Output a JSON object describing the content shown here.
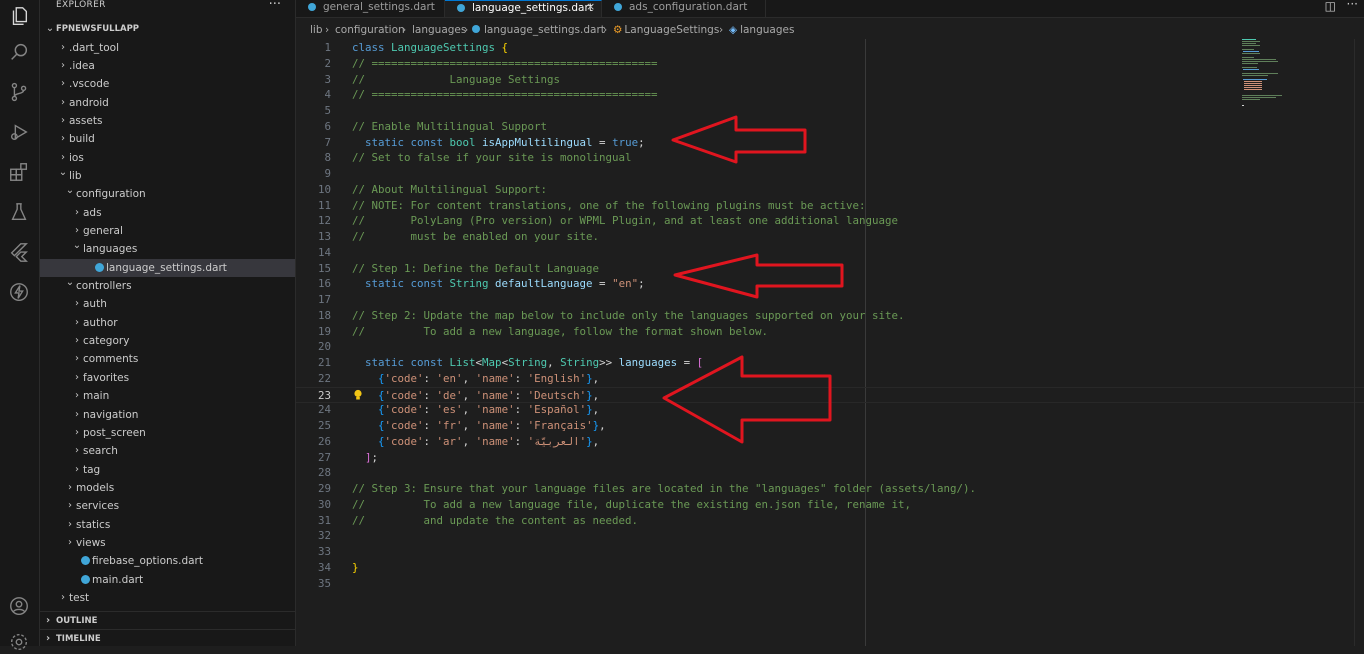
{
  "activity_bar": {
    "icons": [
      "explorer-icon",
      "search-icon",
      "source-control-icon",
      "run-debug-icon",
      "extensions-icon",
      "testing-icon",
      "flutter-icon",
      "lightning-icon",
      "account-icon",
      "settings-icon"
    ]
  },
  "explorer": {
    "title": "EXPLORER",
    "more": "···",
    "root": "FPNEWSFULLAPP",
    "items": [
      {
        "label": ".dart_tool",
        "depth": 1,
        "kind": "folder-closed"
      },
      {
        "label": ".idea",
        "depth": 1,
        "kind": "folder-closed"
      },
      {
        "label": ".vscode",
        "depth": 1,
        "kind": "folder-closed"
      },
      {
        "label": "android",
        "depth": 1,
        "kind": "folder-closed"
      },
      {
        "label": "assets",
        "depth": 1,
        "kind": "folder-closed"
      },
      {
        "label": "build",
        "depth": 1,
        "kind": "folder-closed"
      },
      {
        "label": "ios",
        "depth": 1,
        "kind": "folder-closed"
      },
      {
        "label": "lib",
        "depth": 1,
        "kind": "folder-open"
      },
      {
        "label": "configuration",
        "depth": 2,
        "kind": "folder-open"
      },
      {
        "label": "ads",
        "depth": 3,
        "kind": "folder-closed"
      },
      {
        "label": "general",
        "depth": 3,
        "kind": "folder-closed"
      },
      {
        "label": "languages",
        "depth": 3,
        "kind": "folder-open"
      },
      {
        "label": "language_settings.dart",
        "depth": 4,
        "kind": "dart-file",
        "selected": true
      },
      {
        "label": "controllers",
        "depth": 2,
        "kind": "folder-open"
      },
      {
        "label": "auth",
        "depth": 3,
        "kind": "folder-closed"
      },
      {
        "label": "author",
        "depth": 3,
        "kind": "folder-closed"
      },
      {
        "label": "category",
        "depth": 3,
        "kind": "folder-closed"
      },
      {
        "label": "comments",
        "depth": 3,
        "kind": "folder-closed"
      },
      {
        "label": "favorites",
        "depth": 3,
        "kind": "folder-closed"
      },
      {
        "label": "main",
        "depth": 3,
        "kind": "folder-closed"
      },
      {
        "label": "navigation",
        "depth": 3,
        "kind": "folder-closed"
      },
      {
        "label": "post_screen",
        "depth": 3,
        "kind": "folder-closed"
      },
      {
        "label": "search",
        "depth": 3,
        "kind": "folder-closed"
      },
      {
        "label": "tag",
        "depth": 3,
        "kind": "folder-closed"
      },
      {
        "label": "models",
        "depth": 2,
        "kind": "folder-closed"
      },
      {
        "label": "services",
        "depth": 2,
        "kind": "folder-closed"
      },
      {
        "label": "statics",
        "depth": 2,
        "kind": "folder-closed"
      },
      {
        "label": "views",
        "depth": 2,
        "kind": "folder-closed"
      },
      {
        "label": "firebase_options.dart",
        "depth": 2,
        "kind": "dart-file"
      },
      {
        "label": "main.dart",
        "depth": 2,
        "kind": "dart-file"
      },
      {
        "label": "test",
        "depth": 1,
        "kind": "folder-closed"
      }
    ],
    "outline": "OUTLINE",
    "timeline": "TIMELINE"
  },
  "tabs": [
    {
      "label": "general_settings.dart",
      "active": false
    },
    {
      "label": "language_settings.dart",
      "active": true,
      "close": "×"
    },
    {
      "label": "ads_configuration.dart",
      "active": false
    }
  ],
  "breadcrumb": [
    "lib",
    "configuration",
    "languages",
    "language_settings.dart",
    "LanguageSettings",
    "languages"
  ],
  "breadcrumb_sep": "›",
  "code_lines": [
    [
      {
        "t": "class ",
        "c": "kw"
      },
      {
        "t": "LanguageSettings",
        "c": "cls"
      },
      {
        "t": " {",
        "c": "y"
      }
    ],
    [
      {
        "t": "// ============================================",
        "c": "cmt"
      }
    ],
    [
      {
        "t": "//             Language Settings",
        "c": "cmt"
      }
    ],
    [
      {
        "t": "// ============================================",
        "c": "cmt"
      }
    ],
    [],
    [
      {
        "t": "// Enable Multilingual Support",
        "c": "cmt"
      }
    ],
    [
      {
        "t": "  static const ",
        "c": "kw"
      },
      {
        "t": "bool ",
        "c": "cls"
      },
      {
        "t": "isAppMultilingual",
        "c": "var"
      },
      {
        "t": " = ",
        "c": "p"
      },
      {
        "t": "true",
        "c": "kw"
      },
      {
        "t": ";",
        "c": "p"
      }
    ],
    [
      {
        "t": "// Set to false if your site is monolingual",
        "c": "cmt"
      }
    ],
    [],
    [
      {
        "t": "// About Multilingual Support:",
        "c": "cmt"
      }
    ],
    [
      {
        "t": "// NOTE: For content translations, one of the following plugins must be active:",
        "c": "cmt"
      }
    ],
    [
      {
        "t": "//       PolyLang (Pro version) or WPML Plugin, and at least one additional language",
        "c": "cmt"
      }
    ],
    [
      {
        "t": "//       must be enabled on your site.",
        "c": "cmt"
      }
    ],
    [],
    [
      {
        "t": "// Step 1: Define the Default Language",
        "c": "cmt"
      }
    ],
    [
      {
        "t": "  static const ",
        "c": "kw"
      },
      {
        "t": "String ",
        "c": "cls"
      },
      {
        "t": "defaultLanguage",
        "c": "var"
      },
      {
        "t": " = ",
        "c": "p"
      },
      {
        "t": "\"en\"",
        "c": "str"
      },
      {
        "t": ";",
        "c": "p"
      }
    ],
    [],
    [
      {
        "t": "// Step 2: Update the map below to include only the languages supported on your site.",
        "c": "cmt"
      }
    ],
    [
      {
        "t": "//         To add a new language, follow the format shown below.",
        "c": "cmt"
      }
    ],
    [],
    [
      {
        "t": "  static const ",
        "c": "kw"
      },
      {
        "t": "List",
        "c": "cls"
      },
      {
        "t": "<",
        "c": "p"
      },
      {
        "t": "Map",
        "c": "cls"
      },
      {
        "t": "<",
        "c": "p"
      },
      {
        "t": "String",
        "c": "cls"
      },
      {
        "t": ", ",
        "c": "p"
      },
      {
        "t": "String",
        "c": "cls"
      },
      {
        "t": ">> ",
        "c": "p"
      },
      {
        "t": "languages",
        "c": "var"
      },
      {
        "t": " = ",
        "c": "p"
      },
      {
        "t": "[",
        "c": "br1"
      }
    ],
    [
      {
        "t": "    {",
        "c": "br2"
      },
      {
        "t": "'code'",
        "c": "str"
      },
      {
        "t": ": ",
        "c": "p"
      },
      {
        "t": "'en'",
        "c": "str"
      },
      {
        "t": ", ",
        "c": "p"
      },
      {
        "t": "'name'",
        "c": "str"
      },
      {
        "t": ": ",
        "c": "p"
      },
      {
        "t": "'English'",
        "c": "str"
      },
      {
        "t": "}",
        "c": "br2"
      },
      {
        "t": ",",
        "c": "p"
      }
    ],
    [
      {
        "t": "    {",
        "c": "br2"
      },
      {
        "t": "'code'",
        "c": "str"
      },
      {
        "t": ": ",
        "c": "p"
      },
      {
        "t": "'de'",
        "c": "str"
      },
      {
        "t": ", ",
        "c": "p"
      },
      {
        "t": "'name'",
        "c": "str"
      },
      {
        "t": ": ",
        "c": "p"
      },
      {
        "t": "'Deutsch'",
        "c": "str"
      },
      {
        "t": "}",
        "c": "br2"
      },
      {
        "t": ",",
        "c": "p"
      }
    ],
    [
      {
        "t": "    {",
        "c": "br2"
      },
      {
        "t": "'code'",
        "c": "str"
      },
      {
        "t": ": ",
        "c": "p"
      },
      {
        "t": "'es'",
        "c": "str"
      },
      {
        "t": ", ",
        "c": "p"
      },
      {
        "t": "'name'",
        "c": "str"
      },
      {
        "t": ": ",
        "c": "p"
      },
      {
        "t": "'Español'",
        "c": "str"
      },
      {
        "t": "}",
        "c": "br2"
      },
      {
        "t": ",",
        "c": "p"
      }
    ],
    [
      {
        "t": "    {",
        "c": "br2"
      },
      {
        "t": "'code'",
        "c": "str"
      },
      {
        "t": ": ",
        "c": "p"
      },
      {
        "t": "'fr'",
        "c": "str"
      },
      {
        "t": ", ",
        "c": "p"
      },
      {
        "t": "'name'",
        "c": "str"
      },
      {
        "t": ": ",
        "c": "p"
      },
      {
        "t": "'Français'",
        "c": "str"
      },
      {
        "t": "}",
        "c": "br2"
      },
      {
        "t": ",",
        "c": "p"
      }
    ],
    [
      {
        "t": "    {",
        "c": "br2"
      },
      {
        "t": "'code'",
        "c": "str"
      },
      {
        "t": ": ",
        "c": "p"
      },
      {
        "t": "'ar'",
        "c": "str"
      },
      {
        "t": ", ",
        "c": "p"
      },
      {
        "t": "'name'",
        "c": "str"
      },
      {
        "t": ": ",
        "c": "p"
      },
      {
        "t": "'العربيّة'",
        "c": "str"
      },
      {
        "t": "}",
        "c": "br2"
      },
      {
        "t": ",",
        "c": "p"
      }
    ],
    [
      {
        "t": "  ]",
        "c": "br1"
      },
      {
        "t": ";",
        "c": "p"
      }
    ],
    [],
    [
      {
        "t": "// Step 3: Ensure that your language files are located in the \"languages\" folder (assets/lang/).",
        "c": "cmt"
      }
    ],
    [
      {
        "t": "//         To add a new language file, duplicate the existing en.json file, rename it,",
        "c": "cmt"
      }
    ],
    [
      {
        "t": "//         and update the content as needed.",
        "c": "cmt"
      }
    ],
    [],
    [],
    [
      {
        "t": "}",
        "c": "y"
      }
    ],
    []
  ],
  "current_line": 23,
  "lightbulb_line": 23,
  "annotation_arrows": 3,
  "colors": {
    "annotation_arrow": "#e0151f",
    "accent": "#0078d4",
    "dart_icon": "#40a6d8"
  }
}
